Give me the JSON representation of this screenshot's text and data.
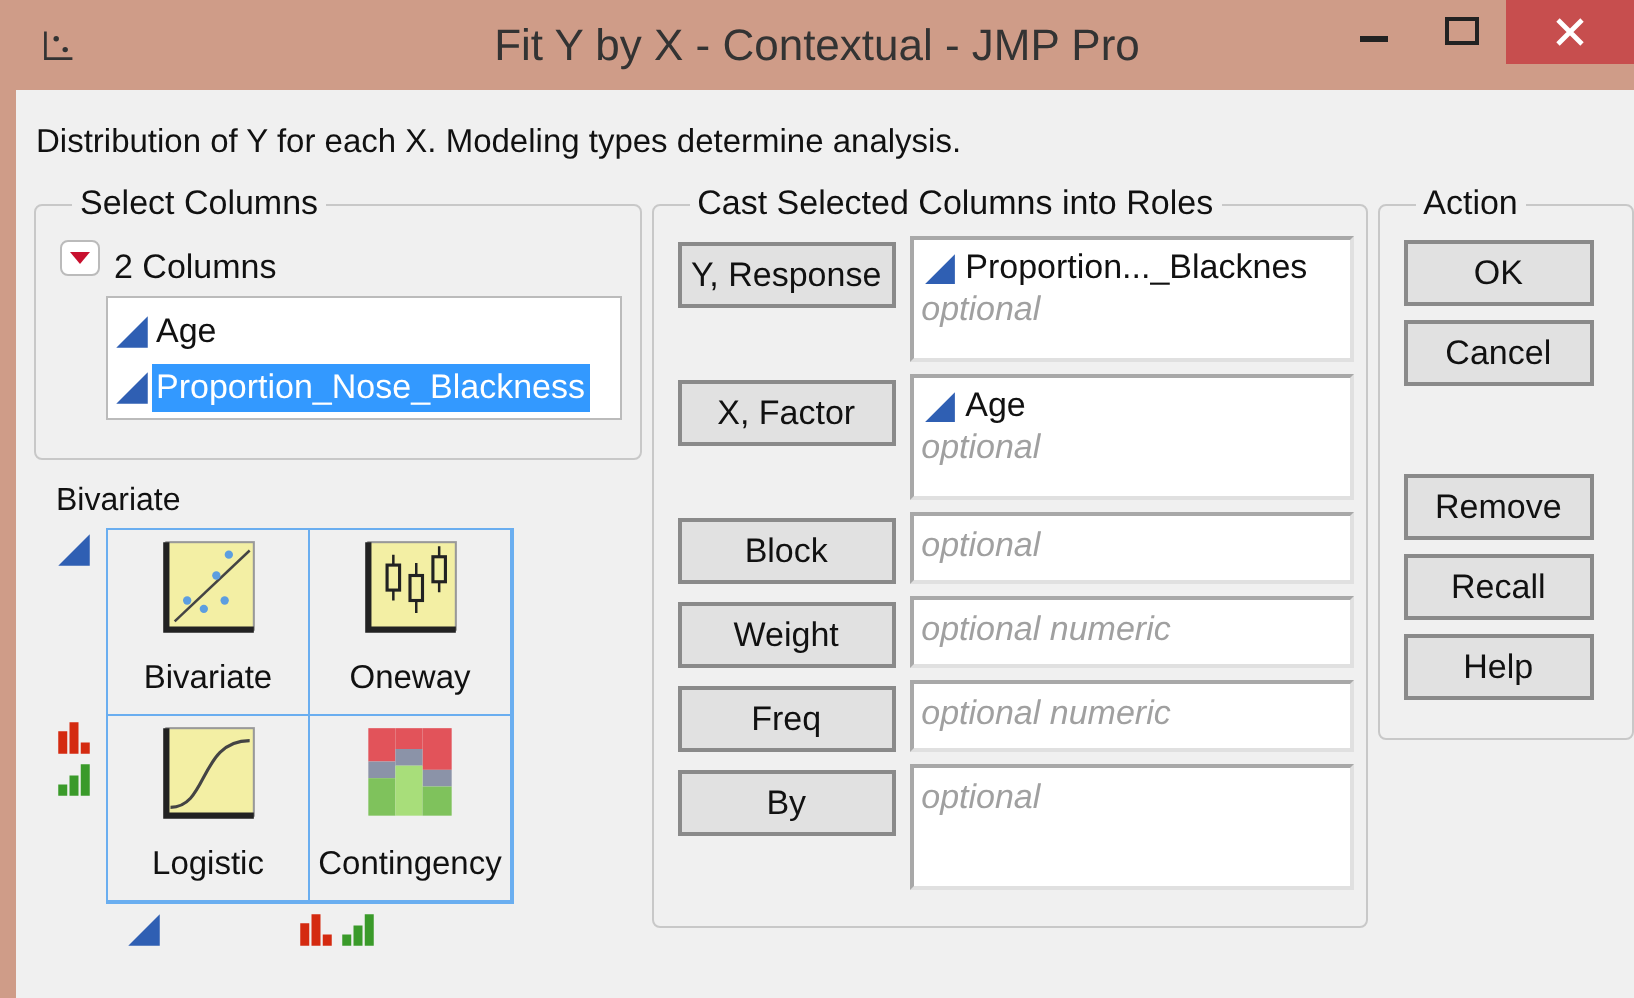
{
  "window": {
    "title": "Fit Y by X - Contextual - JMP Pro"
  },
  "description": "Distribution of Y for each X. Modeling types determine analysis.",
  "select_columns": {
    "title": "Select Columns",
    "count_label": "2 Columns",
    "columns": [
      {
        "name": "Age",
        "selected": false
      },
      {
        "name": "Proportion_Nose_Blackness",
        "selected": true
      }
    ]
  },
  "platform": {
    "title": "Bivariate",
    "cells": [
      {
        "label": "Bivariate",
        "kind": "bivariate"
      },
      {
        "label": "Oneway",
        "kind": "oneway"
      },
      {
        "label": "Logistic",
        "kind": "logistic"
      },
      {
        "label": "Contingency",
        "kind": "contingency"
      }
    ]
  },
  "roles": {
    "title": "Cast Selected Columns into Roles",
    "items": [
      {
        "button": "Y, Response",
        "kind": "list",
        "values": [
          "Proportion..._Blacknes"
        ],
        "placeholder": "optional"
      },
      {
        "button": "X, Factor",
        "kind": "list",
        "values": [
          "Age"
        ],
        "placeholder": "optional"
      },
      {
        "button": "Block",
        "kind": "single",
        "placeholder": "optional"
      },
      {
        "button": "Weight",
        "kind": "single",
        "placeholder": "optional numeric"
      },
      {
        "button": "Freq",
        "kind": "single",
        "placeholder": "optional numeric"
      },
      {
        "button": "By",
        "kind": "list",
        "placeholder": "optional"
      }
    ]
  },
  "action": {
    "title": "Action",
    "groups": [
      [
        "OK",
        "Cancel"
      ],
      [
        "Remove",
        "Recall",
        "Help"
      ]
    ]
  }
}
